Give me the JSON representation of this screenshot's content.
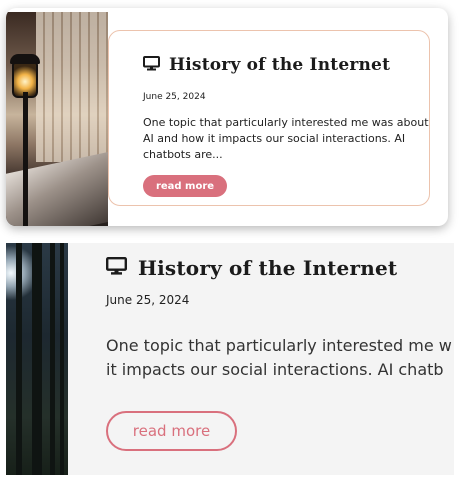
{
  "cards": [
    {
      "icon": "computer-monitor-icon",
      "title": "History of the Internet",
      "date": "June 25, 2024",
      "excerpt": "One topic that particularly interested me was about AI and how it impacts our social interactions. AI chatbots are...",
      "button_label": "read more"
    },
    {
      "icon": "computer-monitor-icon",
      "title": "History of the Internet",
      "date": "June 25, 2024",
      "excerpt_line1": "One topic that particularly interested me w",
      "excerpt_line2": "it impacts our social interactions. AI chatb",
      "button_label": "read more"
    }
  ],
  "colors": {
    "accent": "#d9707d",
    "card_border": "#ecc3ad",
    "card2_background": "#f4f4f4"
  }
}
